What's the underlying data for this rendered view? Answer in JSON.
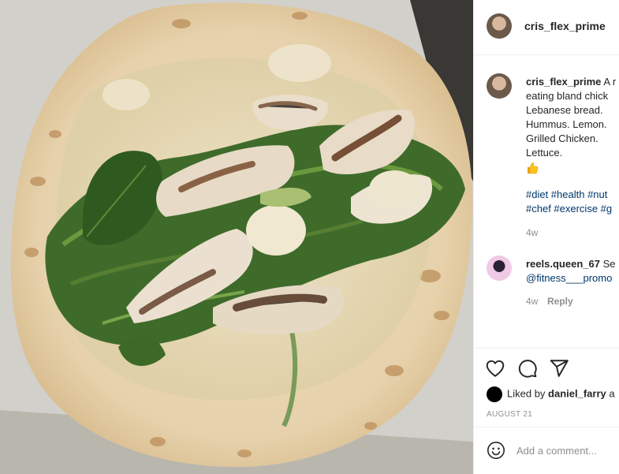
{
  "post": {
    "owner": "cris_flex_prime",
    "caption": {
      "username": "cris_flex_prime",
      "first_line": "A r",
      "lines": [
        "eating bland chick",
        "Lebanese bread.",
        "Hummus. Lemon.",
        "Grilled Chicken.",
        "Lettuce."
      ],
      "emoji": "thumbs-up-emoji"
    },
    "hashtags": [
      "#diet #health #nut",
      "#chef #exercise #g"
    ],
    "caption_time": "4w"
  },
  "comments": [
    {
      "username": "reels.queen_67",
      "text": "Se",
      "mention": "@fitness___promo",
      "time": "4w",
      "reply_label": "Reply"
    }
  ],
  "likes": {
    "prefix": "Liked by",
    "username": "daniel_farry",
    "suffix": "a"
  },
  "date": "AUGUST 21",
  "add_comment": {
    "placeholder": "Add a comment..."
  },
  "icons": [
    "heart-icon",
    "comment-icon",
    "share-icon",
    "smiley-icon"
  ]
}
